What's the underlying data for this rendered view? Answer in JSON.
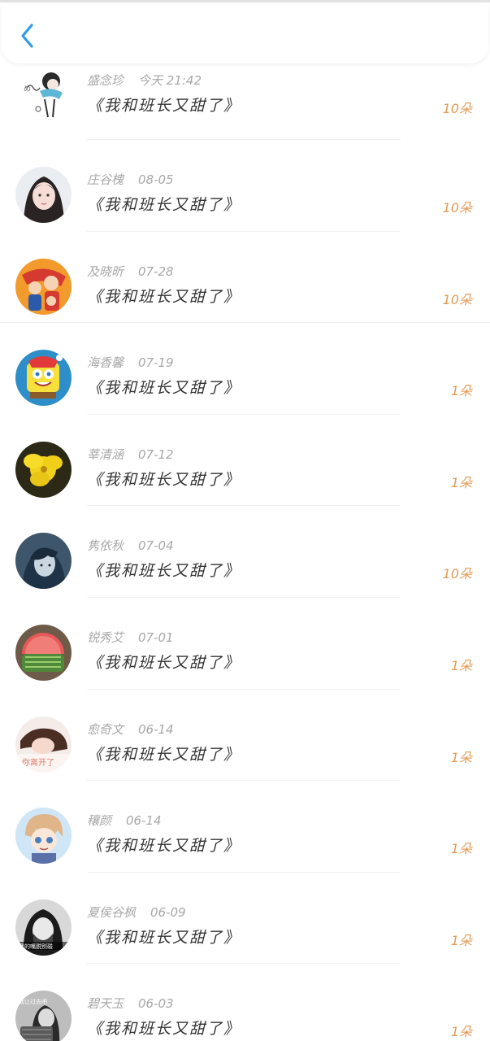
{
  "header": {
    "back_icon": "chevron-left-icon",
    "accent_color": "#2f9be9"
  },
  "count_color": "#e39a55",
  "items": [
    {
      "name": "盛念珍",
      "date": "今天 21:42",
      "title": "《我和班长又甜了》",
      "count": "10朵"
    },
    {
      "name": "庄谷槐",
      "date": "08-05",
      "title": "《我和班长又甜了》",
      "count": "10朵"
    },
    {
      "name": "及晓昕",
      "date": "07-28",
      "title": "《我和班长又甜了》",
      "count": "10朵"
    },
    {
      "name": "海香馨",
      "date": "07-19",
      "title": "《我和班长又甜了》",
      "count": "1朵"
    },
    {
      "name": "莘清涵",
      "date": "07-12",
      "title": "《我和班长又甜了》",
      "count": "1朵"
    },
    {
      "name": "隽依秋",
      "date": "07-04",
      "title": "《我和班长又甜了》",
      "count": "10朵"
    },
    {
      "name": "锐秀艾",
      "date": "07-01",
      "title": "《我和班长又甜了》",
      "count": "1朵"
    },
    {
      "name": "愈奇文",
      "date": "06-14",
      "title": "《我和班长又甜了》",
      "count": "1朵"
    },
    {
      "name": "穰颜",
      "date": "06-14",
      "title": "《我和班长又甜了》",
      "count": "1朵"
    },
    {
      "name": "夏侯谷枫",
      "date": "06-09",
      "title": "《我和班长又甜了》",
      "count": "1朵"
    },
    {
      "name": "碧天玉",
      "date": "06-03",
      "title": "《我和班长又甜了》",
      "count": "1朵"
    }
  ]
}
